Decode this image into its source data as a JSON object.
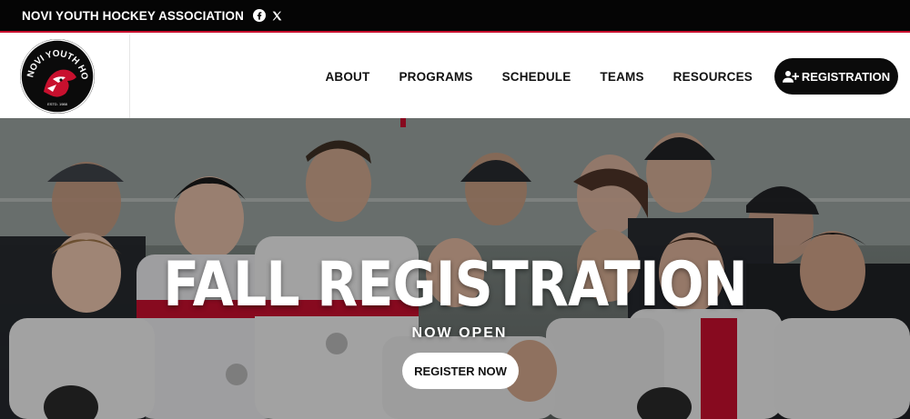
{
  "topbar": {
    "org_name": "NOVI YOUTH HOCKEY ASSOCIATION",
    "social": [
      {
        "icon": "facebook-icon"
      },
      {
        "icon": "x-icon"
      }
    ]
  },
  "logo": {
    "text": "NOVI YOUTH HOCKEY",
    "est": "ESTD. 1988"
  },
  "nav": {
    "items": [
      {
        "label": "ABOUT"
      },
      {
        "label": "PROGRAMS"
      },
      {
        "label": "SCHEDULE"
      },
      {
        "label": "TEAMS"
      },
      {
        "label": "RESOURCES"
      }
    ],
    "registration": {
      "label": "REGISTRATION",
      "icon": "user-plus-icon"
    }
  },
  "hero": {
    "title": "FALL REGISTRATION",
    "subtitle": "NOW OPEN",
    "button": "REGISTER NOW"
  },
  "colors": {
    "brand_red": "#c8102e",
    "black": "#050505",
    "white": "#ffffff"
  }
}
